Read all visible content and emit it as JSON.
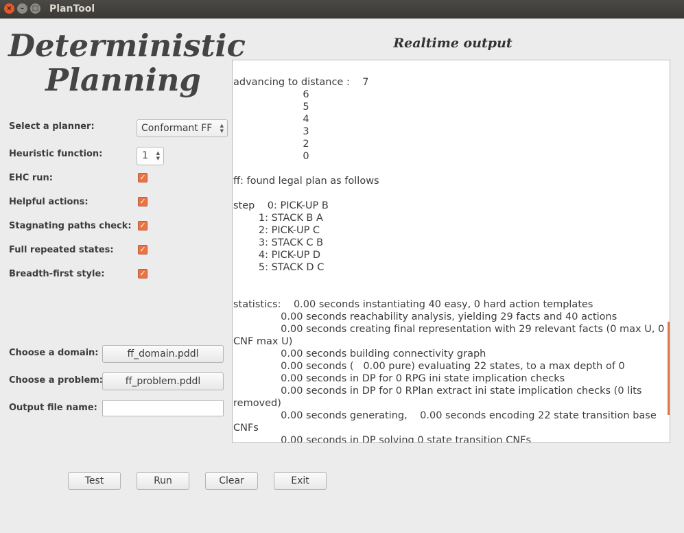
{
  "window": {
    "title": "PlanTool",
    "close_glyph": "×",
    "min_glyph": "–",
    "max_glyph": "□"
  },
  "app": {
    "title_line1": "Deterministic",
    "title_line2": "Planning",
    "output_heading": "Realtime output"
  },
  "settings": {
    "planner_label": "Select a planner:",
    "planner_value": "Conformant FF",
    "heuristic_label": "Heuristic function:",
    "heuristic_value": "1",
    "checkboxes": [
      {
        "label": "EHC run:",
        "checked": true
      },
      {
        "label": "Helpful actions:",
        "checked": true
      },
      {
        "label": "Stagnating paths check:",
        "checked": true
      },
      {
        "label": "Full repeated states:",
        "checked": true
      },
      {
        "label": "Breadth-first style:",
        "checked": true
      }
    ]
  },
  "files": {
    "domain_label": "Choose a domain:",
    "domain_value": "ff_domain.pddl",
    "problem_label": "Choose a problem:",
    "problem_value": "ff_problem.pddl",
    "output_label": "Output file name:",
    "output_value": ""
  },
  "output": {
    "text": "advancing to distance :    7\n                      6\n                      5\n                      4\n                      3\n                      2\n                      0\n\nff: found legal plan as follows\n\nstep    0: PICK-UP B\n        1: STACK B A\n        2: PICK-UP C\n        3: STACK C B\n        4: PICK-UP D\n        5: STACK D C\n\n\nstatistics:    0.00 seconds instantiating 40 easy, 0 hard action templates\n               0.00 seconds reachability analysis, yielding 29 facts and 40 actions\n               0.00 seconds creating final representation with 29 relevant facts (0 max U, 0 CNF max U)\n               0.00 seconds building connectivity graph\n               0.00 seconds (   0.00 pure) evaluating 22 states, to a max depth of 0\n               0.00 seconds in DP for 0 RPG ini state implication checks\n               0.00 seconds in DP for 0 RPlan extract ini state implication checks (0 lits removed)\n               0.00 seconds generating,    0.00 seconds encoding 22 state transition base CNFs\n               0.00 seconds in DP solving 0 state transition CNFs"
  },
  "buttons": {
    "test": "Test",
    "run": "Run",
    "clear": "Clear",
    "exit": "Exit"
  },
  "icons": {
    "checkbox": "check-icon",
    "spinner": "spinner-arrows-icon",
    "combo": "combo-arrows-icon"
  },
  "colors": {
    "accent": "#e87448",
    "titlebar": "#3c3b37",
    "background": "#ececec"
  }
}
